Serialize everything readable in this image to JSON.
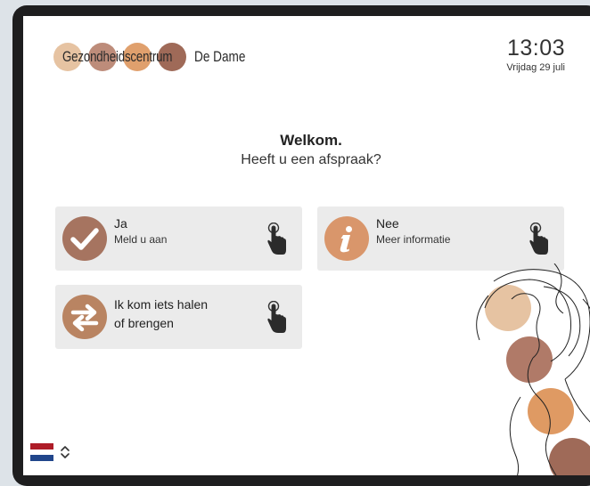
{
  "header": {
    "brand_name": "Gezondheidscentrum",
    "brand_suffix": "De Dame",
    "time": "13:03",
    "date": "Vrijdag 29 juli"
  },
  "welcome": {
    "title": "Welkom.",
    "question": "Heeft u een afspraak?"
  },
  "options": [
    {
      "title": "Ja",
      "subtitle": "Meld u aan",
      "icon": "checkmark-icon",
      "color": "#a67460"
    },
    {
      "title": "Nee",
      "subtitle": "Meer informatie",
      "icon": "info-icon",
      "color": "#d9966b"
    },
    {
      "title_line1": "Ik kom iets halen",
      "title_line2": "of brengen",
      "icon": "swap-arrows-icon",
      "color": "#b98462"
    }
  ],
  "language": {
    "selected": "nl",
    "flag": "netherlands-flag-icon"
  },
  "colors": {
    "logo_dots": [
      "#e6c3a2",
      "#bd8c7a",
      "#e0a06d",
      "#9f6a58"
    ],
    "tile_bg": "#ebebeb"
  }
}
